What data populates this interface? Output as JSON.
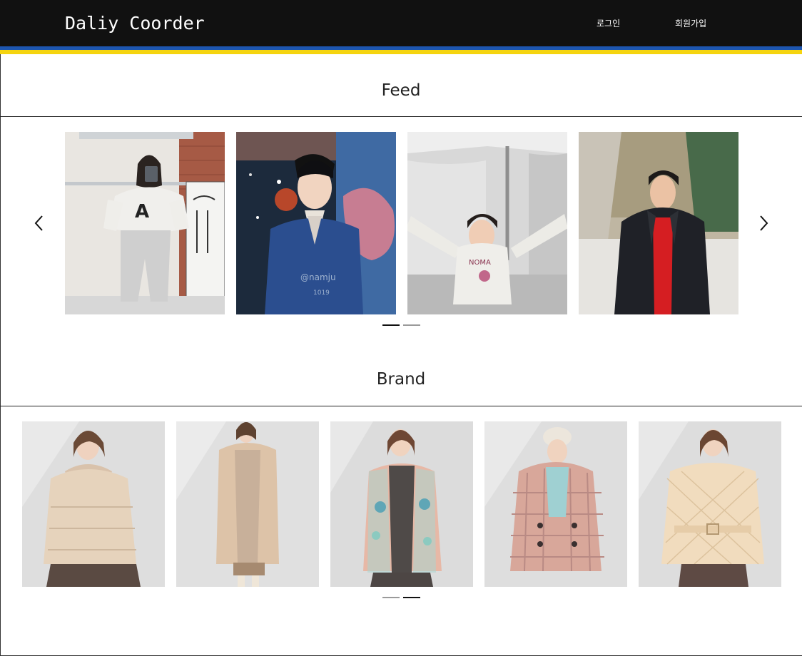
{
  "header": {
    "logo": "Daliy Coorder",
    "login": "로그인",
    "signup": "회원가입"
  },
  "feed": {
    "title": "Feed",
    "photos": [
      {
        "icon": "woman-white-hoodie-photo"
      },
      {
        "icon": "man-navy-jacket-photo",
        "overlay_handle": "@namju",
        "overlay_num": "1019"
      },
      {
        "icon": "woman-arms-up-photo"
      },
      {
        "icon": "man-black-parka-photo"
      }
    ],
    "prev_icon": "chevron-left-icon",
    "next_icon": "chevron-right-icon",
    "dots": [
      {
        "active": true
      },
      {
        "active": false
      }
    ]
  },
  "brand": {
    "title": "Brand",
    "photos": [
      {
        "icon": "beige-puffer-jacket-photo"
      },
      {
        "icon": "beige-long-parka-photo"
      },
      {
        "icon": "floral-cardigan-photo"
      },
      {
        "icon": "plaid-coat-photo"
      },
      {
        "icon": "quilted-jacket-photo"
      }
    ],
    "dots": [
      {
        "active": false
      },
      {
        "active": true
      }
    ]
  },
  "colors": {
    "header_bg": "#111111",
    "stripe_blue": "#1d56b0",
    "stripe_yellow": "#f5d40f"
  }
}
